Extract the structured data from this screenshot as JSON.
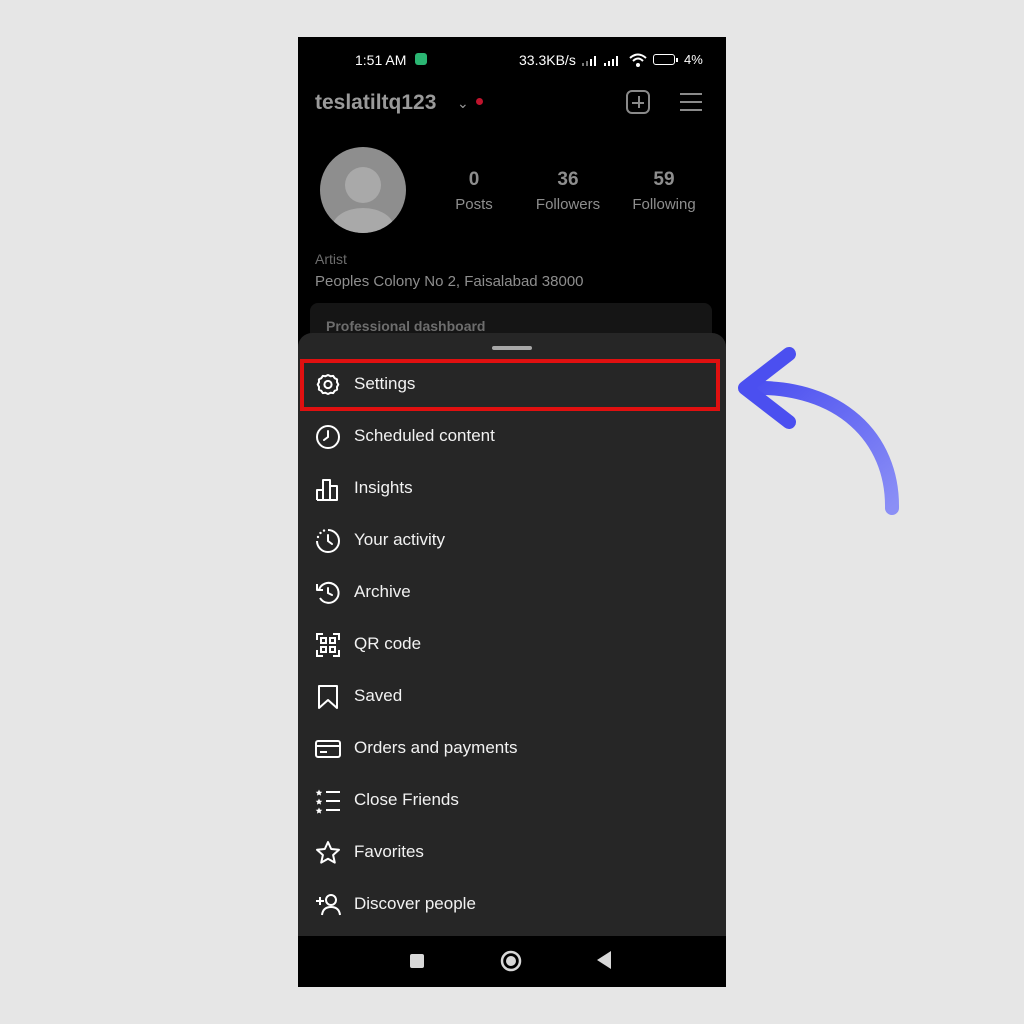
{
  "status_bar": {
    "time": "1:51 AM",
    "speed": "33.3KB/s",
    "battery": "4%"
  },
  "profile": {
    "username": "teslatiltq123",
    "stats": [
      {
        "value": "0",
        "label": "Posts"
      },
      {
        "value": "36",
        "label": "Followers"
      },
      {
        "value": "59",
        "label": "Following"
      }
    ],
    "category": "Artist",
    "address": "Peoples Colony No 2, Faisalabad 38000",
    "dashboard_label": "Professional dashboard"
  },
  "menu": {
    "items": [
      {
        "label": "Settings",
        "icon": "settings-gear-icon"
      },
      {
        "label": "Scheduled content",
        "icon": "clock-icon"
      },
      {
        "label": "Insights",
        "icon": "bar-chart-icon"
      },
      {
        "label": "Your activity",
        "icon": "activity-icon"
      },
      {
        "label": "Archive",
        "icon": "archive-history-icon"
      },
      {
        "label": "QR code",
        "icon": "qr-code-icon"
      },
      {
        "label": "Saved",
        "icon": "bookmark-icon"
      },
      {
        "label": "Orders and payments",
        "icon": "card-icon"
      },
      {
        "label": "Close Friends",
        "icon": "star-list-icon"
      },
      {
        "label": "Favorites",
        "icon": "star-icon"
      },
      {
        "label": "Discover people",
        "icon": "add-person-icon"
      }
    ]
  },
  "colors": {
    "highlight": "#e01010",
    "arrow": "#5b5ff0",
    "sheet": "#262626",
    "background": "#e6e6e6"
  }
}
